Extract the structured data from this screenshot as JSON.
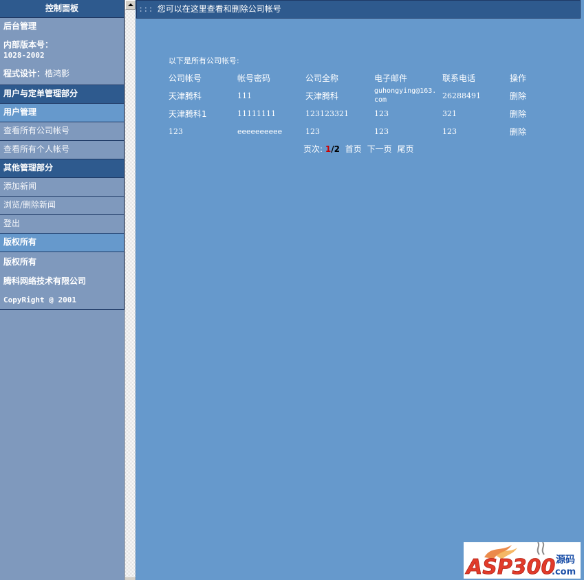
{
  "sidebar": {
    "panel_title": "控制面板",
    "backend": "后台管理",
    "version_label": "内部版本号：",
    "version_value": "1028-2002",
    "designer_label": "程式设计：",
    "designer_name": "梏鸿影",
    "section_user": "用户与定单管理部分",
    "user_mgmt": "用户管理",
    "view_company": "查看所有公司帐号",
    "view_personal": "查看所有个人帐号",
    "section_other": "其他管理部分",
    "add_news": "添加新闻",
    "browse_news": "浏览/删除新闻",
    "logout": "登出",
    "copyright_header": "版权所有",
    "copyright": "版权所有",
    "company": "腾科网络技术有限公司",
    "copyright_en": "CopyRight @ 2001"
  },
  "header": {
    "dots": ":::",
    "text": "您可以在这里查看和删除公司帐号"
  },
  "main": {
    "intro": "以下是所有公司帐号:",
    "columns": [
      "公司帐号",
      "帐号密码",
      "公司全称",
      "电子邮件",
      "联系电话",
      "操作"
    ],
    "rows": [
      [
        "天津腾科",
        "111",
        "天津腾科",
        "guhongying@163.com",
        "26288491",
        "删除"
      ],
      [
        "天津腾科1",
        "11111111",
        "123123321",
        "123",
        "321",
        "删除"
      ],
      [
        "123",
        "eeeeeeeeee",
        "123",
        "123",
        "123",
        "删除"
      ]
    ]
  },
  "pager": {
    "label": "页次:",
    "current": "1",
    "total": "/2",
    "first": "首页",
    "next": "下一页",
    "last": "尾页"
  },
  "logo": {
    "text": "ASP300",
    "suffix": "源码",
    "domain": ".com"
  }
}
